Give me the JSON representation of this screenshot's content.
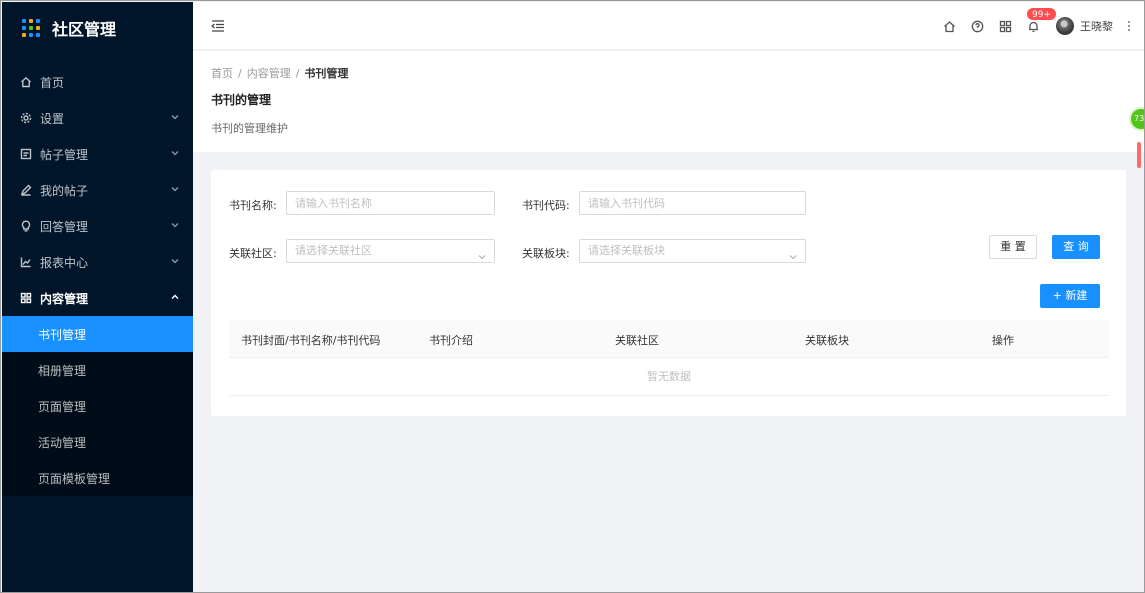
{
  "app": {
    "title": "社区管理"
  },
  "sidebar": {
    "items": [
      {
        "label": "首页",
        "icon": "home-icon"
      },
      {
        "label": "设置",
        "icon": "settings-icon"
      },
      {
        "label": "帖子管理",
        "icon": "post-icon"
      },
      {
        "label": "我的帖子",
        "icon": "edit-icon"
      },
      {
        "label": "回答管理",
        "icon": "bulb-icon"
      },
      {
        "label": "报表中心",
        "icon": "line-chart-icon"
      },
      {
        "label": "内容管理",
        "icon": "appstore-icon"
      }
    ],
    "submenu": [
      {
        "label": "书刊管理",
        "active": true
      },
      {
        "label": "相册管理"
      },
      {
        "label": "页面管理"
      },
      {
        "label": "活动管理"
      },
      {
        "label": "页面模板管理"
      }
    ]
  },
  "header": {
    "notifications_badge": "99+",
    "username": "王晓黎"
  },
  "breadcrumb": {
    "level1": "首页",
    "level2": "内容管理",
    "current": "书刊管理",
    "separator": "/"
  },
  "page": {
    "title": "书刊的管理",
    "description": "书刊的管理维护"
  },
  "float_ball_text": "73",
  "form": {
    "name_label": "书刊名称:",
    "name_placeholder": "请输入书刊名称",
    "code_label": "书刊代码:",
    "code_placeholder": "请输入书刊代码",
    "community_label": "关联社区:",
    "community_placeholder": "请选择关联社区",
    "section_label": "关联板块:",
    "section_placeholder": "请选择关联板块",
    "reset_label": "重 置",
    "query_label": "查 询",
    "new_label": "+ 新建"
  },
  "table": {
    "columns": [
      "书刊封面/书刊名称/书刊代码",
      "书刊介绍",
      "关联社区",
      "关联板块",
      "操作"
    ],
    "empty_text": "暂无数据"
  }
}
